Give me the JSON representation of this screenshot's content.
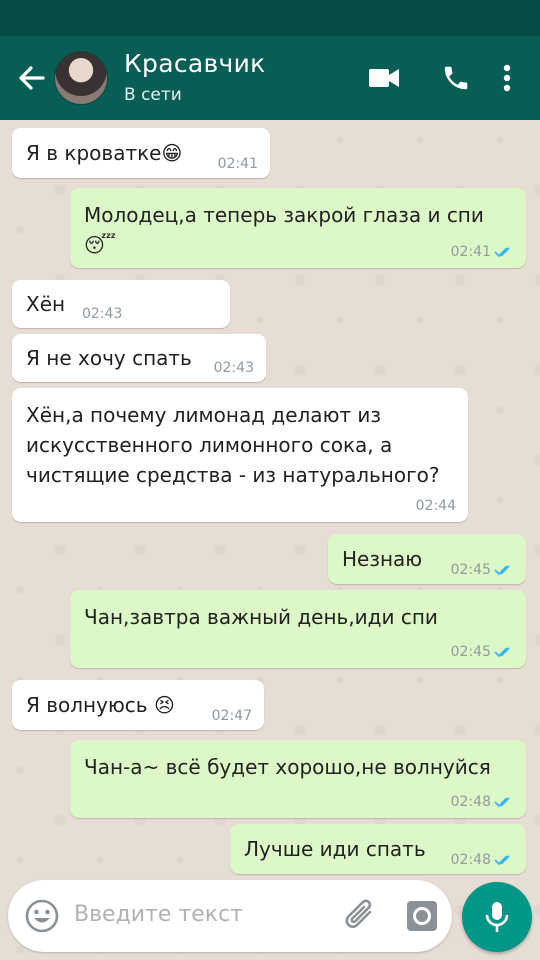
{
  "header": {
    "contact_name": "Красавчик",
    "contact_status": "В сети",
    "icons": [
      "back-arrow-icon",
      "video-call-icon",
      "voice-call-icon",
      "more-options-icon"
    ]
  },
  "messages": [
    {
      "dir": "in",
      "text": "Я в кроватке😁",
      "time": "02:41"
    },
    {
      "dir": "out",
      "text": "Молодец,а теперь закрой глаза и спи 😴",
      "time": "02:41",
      "read": true
    },
    {
      "dir": "in",
      "text": "Хён",
      "time": "02:43"
    },
    {
      "dir": "in",
      "text": "Я не хочу спать",
      "time": "02:43"
    },
    {
      "dir": "in",
      "text": "Хён,а почему лимонад делают из искусственного лимонного сока, а чистящие средства - из натурального?",
      "time": "02:44"
    },
    {
      "dir": "out",
      "text": "Незнаю",
      "time": "02:45",
      "read": true
    },
    {
      "dir": "out",
      "text": "Чан,завтра важный день,иди спи",
      "time": "02:45",
      "read": true
    },
    {
      "dir": "in",
      "text": "Я волнуюсь 😣",
      "time": "02:47"
    },
    {
      "dir": "out",
      "text": "Чан-а~ всё будет хорошо,не волнуйся",
      "time": "02:48",
      "read": true
    },
    {
      "dir": "out",
      "text": "Лучше иди спать",
      "time": "02:48",
      "read": true
    }
  ],
  "input": {
    "placeholder": "Введите текст"
  },
  "colors": {
    "header": "#075e54",
    "status_bar": "#054d44",
    "outgoing_bubble": "#dcf8c6",
    "incoming_bubble": "#ffffff",
    "read_ticks": "#34b7f1",
    "mic_button": "#009688"
  }
}
